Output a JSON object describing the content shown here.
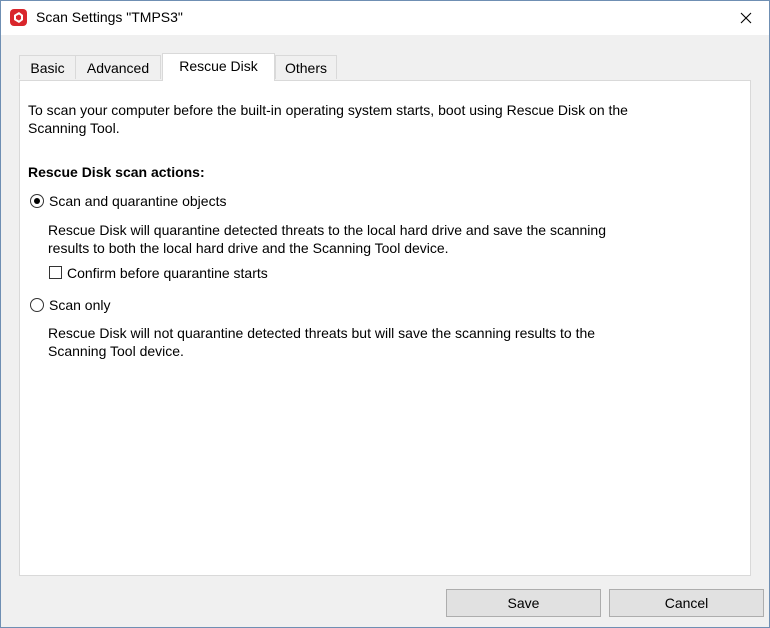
{
  "window": {
    "title": "Scan Settings \"TMPS3\"",
    "close_icon": "close-icon",
    "app_icon": "app-logo-icon",
    "accent": "#d9262c"
  },
  "tabs": [
    {
      "label": "Basic",
      "active": false
    },
    {
      "label": "Advanced",
      "active": false
    },
    {
      "label": "Rescue Disk",
      "active": true
    },
    {
      "label": "Others",
      "active": false
    }
  ],
  "panel": {
    "intro_line1": "To scan your computer before the built-in operating system starts, boot using Rescue Disk on the",
    "intro_line2": "Scanning Tool.",
    "section_heading": "Rescue Disk scan actions:",
    "option1": {
      "label": "Scan and quarantine objects",
      "selected": true,
      "desc_line1": "Rescue Disk will quarantine detected threats to the local hard drive and save the scanning",
      "desc_line2": "results to both the local hard drive and the Scanning Tool device.",
      "confirm_label": "Confirm before quarantine starts",
      "confirm_checked": false
    },
    "option2": {
      "label": "Scan only",
      "selected": false,
      "desc_line1": "Rescue Disk will not quarantine detected threats but will save the scanning results to the",
      "desc_line2": "Scanning Tool device."
    }
  },
  "buttons": {
    "save": "Save",
    "cancel": "Cancel"
  }
}
